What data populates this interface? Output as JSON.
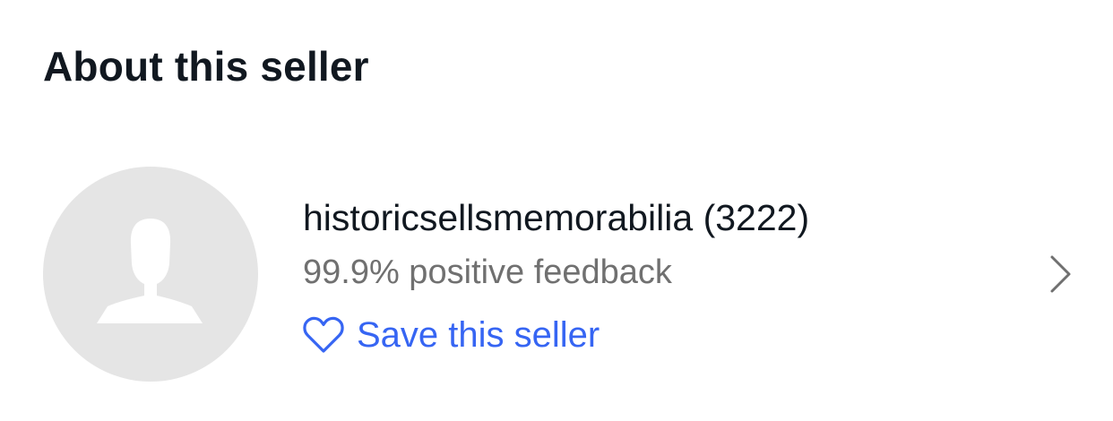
{
  "section": {
    "title": "About this seller"
  },
  "seller": {
    "name_with_count": "historicsellsmemorabilia (3222)",
    "feedback": "99.9% positive feedback",
    "save_label": "Save this seller"
  },
  "icons": {
    "avatar": "default-user-silhouette-icon",
    "save": "heart-outline-icon",
    "navigate": "chevron-right-icon"
  },
  "colors": {
    "title": "#111820",
    "secondary_text": "#707070",
    "link": "#3665f3",
    "avatar_background": "#e5e5e5",
    "chevron": "#707070"
  }
}
